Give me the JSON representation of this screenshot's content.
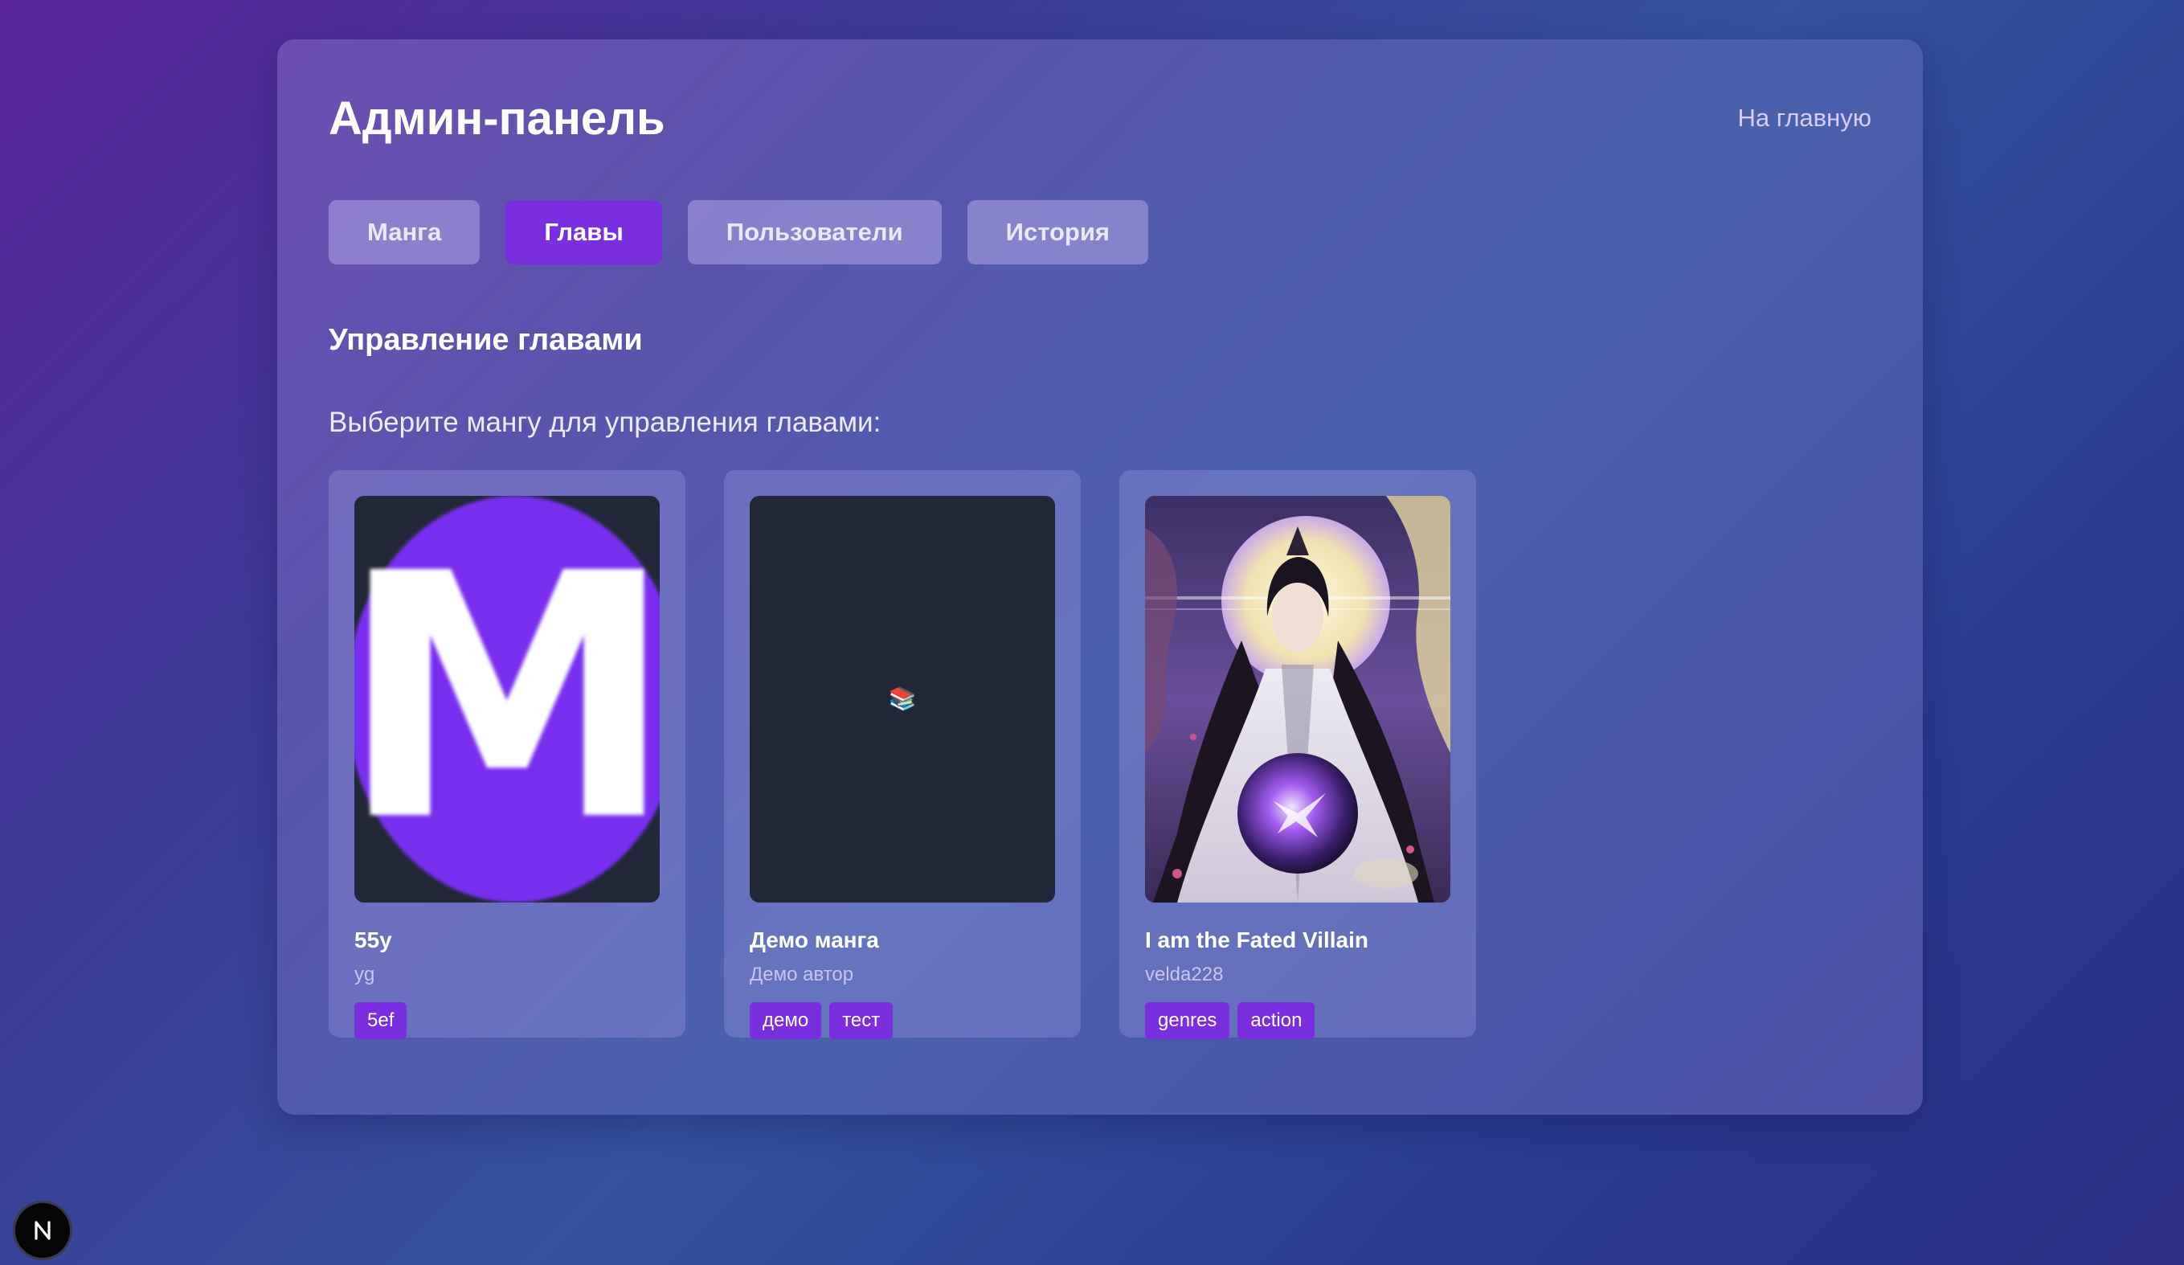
{
  "header": {
    "title": "Админ-панель",
    "home_link": "На главную"
  },
  "tabs": [
    {
      "label": "Манга",
      "active": false
    },
    {
      "label": "Главы",
      "active": true
    },
    {
      "label": "Пользователи",
      "active": false
    },
    {
      "label": "История",
      "active": false
    }
  ],
  "section": {
    "title": "Управление главами",
    "subtitle": "Выберите мангу для управления главами:"
  },
  "manga": [
    {
      "title": "55y",
      "author": "yg",
      "tags": [
        "5ef"
      ],
      "cover": "letter-m-logo"
    },
    {
      "title": "Демо манга",
      "author": "Демо автор",
      "tags": [
        "демо",
        "тест"
      ],
      "cover": "books-icon"
    },
    {
      "title": "I am the Fated Villain",
      "author": "velda228",
      "tags": [
        "genres",
        "action"
      ],
      "cover": "anime-illustration"
    }
  ],
  "placeholders": {
    "cover_icon": "📚",
    "cover_letter": "M"
  },
  "dev_badge": {
    "label": "N",
    "icon": "nextjs-dev-indicator-icon"
  },
  "colors": {
    "accent": "#7a2ee0",
    "tab_inactive": "#9c8fd6",
    "cover_dark": "#222837"
  }
}
